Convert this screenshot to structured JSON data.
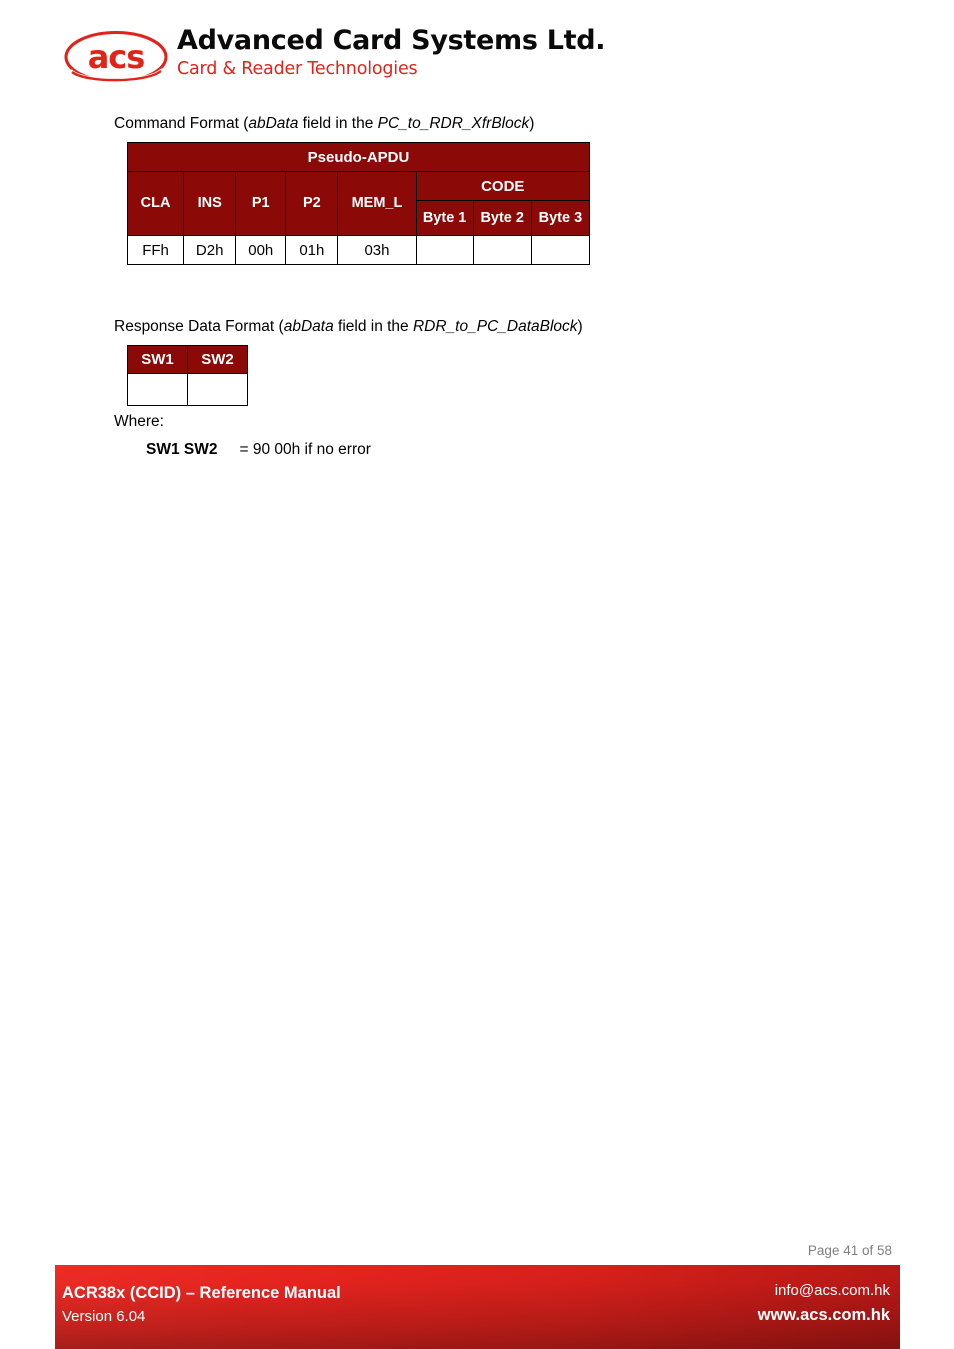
{
  "brand": {
    "logo_text": "acs",
    "title": "Advanced Card Systems Ltd.",
    "subtitle": "Card & Reader Technologies"
  },
  "content": {
    "command_caption_1": "Command Format (",
    "command_caption_em1": "abData",
    "command_caption_2": " field in the ",
    "command_caption_em2": "PC_to_RDR_XfrBlock",
    "command_caption_3": ")",
    "response_caption_1": "Response Data Format (",
    "response_caption_em1": "abData",
    "response_caption_2": " field in the ",
    "response_caption_em2": "RDR_to_PC_DataBlock",
    "response_caption_3": ")",
    "where_label": "Where:",
    "sw_term": "SW1 SW2",
    "sw_definition": "= 90 00h if no error"
  },
  "command_table": {
    "title": "Pseudo-APDU",
    "code_group": "CODE",
    "fields": [
      "CLA",
      "INS",
      "P1",
      "P2",
      "MEM_L"
    ],
    "code_bytes": [
      "Byte 1",
      "Byte 2",
      "Byte 3"
    ],
    "values": [
      "FFh",
      "D2h",
      "00h",
      "01h",
      "03h",
      "",
      "",
      ""
    ]
  },
  "response_table": {
    "headers": [
      "SW1",
      "SW2"
    ],
    "values": [
      "",
      ""
    ]
  },
  "footer": {
    "page_number": "Page 41 of 58",
    "manual_title": "ACR38x (CCID) – Reference Manual",
    "version": "Version 6.04",
    "email": "info@acs.com.hk",
    "website": "www.acs.com.hk"
  },
  "colors": {
    "table_header": "#8B0A08",
    "brand_red": "#e2231a",
    "footer_red": "#e8241f",
    "page_number_gray": "#808080"
  }
}
